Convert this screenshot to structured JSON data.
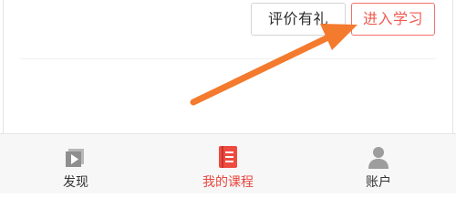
{
  "actions": {
    "review_label": "评价有礼",
    "study_label": "进入学习"
  },
  "tabbar": {
    "items": [
      {
        "label": "发现",
        "icon": "play-video-icon",
        "active": false
      },
      {
        "label": "我的课程",
        "icon": "course-book-icon",
        "active": true
      },
      {
        "label": "账户",
        "icon": "user-avatar-icon",
        "active": false
      }
    ]
  },
  "annotation": {
    "arrow_icon": "orange-pointer-arrow-icon",
    "arrow_color": "#f47a2e"
  },
  "colors": {
    "accent": "#e8463f",
    "study_border": "#f0716b",
    "tabbar_bg": "#f7f7f7"
  }
}
